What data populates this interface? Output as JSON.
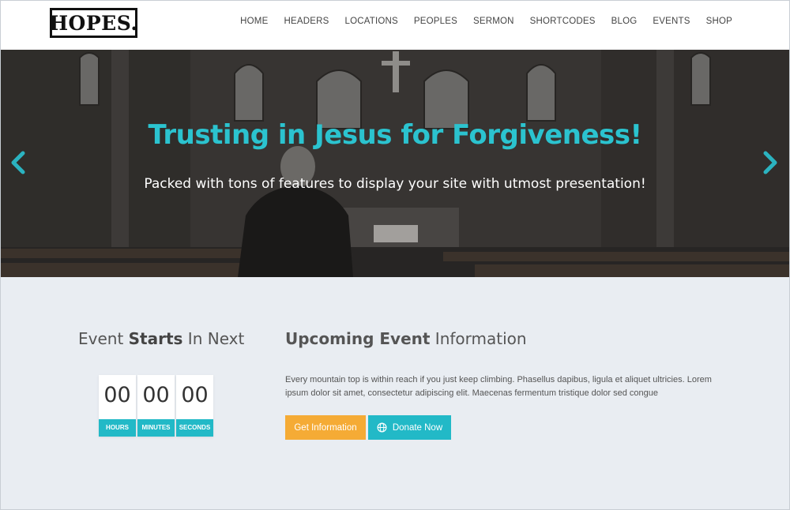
{
  "header": {
    "logo": "HOPES.",
    "nav": [
      "HOME",
      "HEADERS",
      "LOCATIONS",
      "PEOPLES",
      "SERMON",
      "SHORTCODES",
      "BLOG",
      "EVENTS",
      "SHOP"
    ]
  },
  "hero": {
    "title": "Trusting in Jesus for Forgiveness!",
    "subtitle": "Packed with tons of features to display your site with utmost presentation!",
    "accent_color": "#2bc3cf"
  },
  "countdown": {
    "title_pre": "Event ",
    "title_bold": "Starts",
    "title_post": " In Next",
    "units": [
      {
        "value": "00",
        "label": "HOURS"
      },
      {
        "value": "00",
        "label": "MINUTES"
      },
      {
        "value": "00",
        "label": "SECONDS"
      }
    ]
  },
  "event": {
    "title_bold": "Upcoming Event",
    "title_post": " Information",
    "description": "Every mountain top is within reach if you just keep climbing. Phasellus dapibus, ligula et aliquet ultricies. Lorem ipsum dolor sit amet, consectetur adipiscing elit. Maecenas fermentum tristique dolor sed congue",
    "info_button": "Get Information",
    "donate_button": "Donate Now",
    "info_color": "#f5ab35",
    "donate_color": "#22b9c7"
  }
}
